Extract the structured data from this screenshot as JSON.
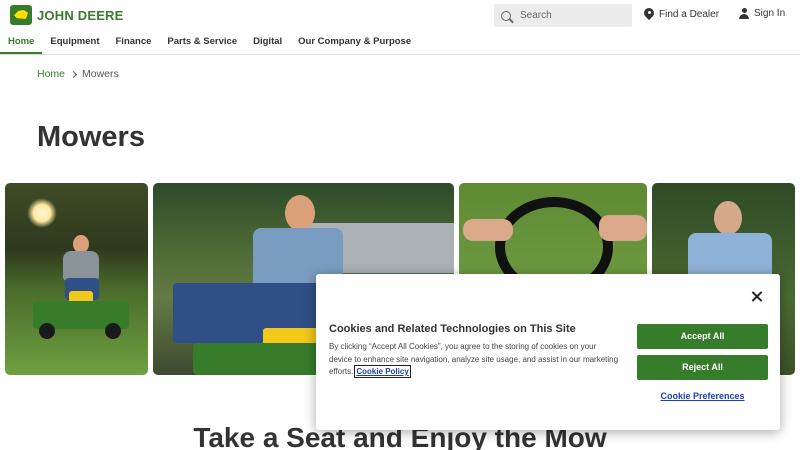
{
  "brand": {
    "logo_text": "JOHN DEERE",
    "logo_colors": {
      "green": "#367c2b",
      "yellow": "#ffde00"
    }
  },
  "header": {
    "search_placeholder": "Search",
    "find_dealer": "Find a Dealer",
    "sign_in": "Sign In"
  },
  "nav": {
    "items": [
      {
        "label": "Home",
        "active": true
      },
      {
        "label": "Equipment"
      },
      {
        "label": "Finance"
      },
      {
        "label": "Parts & Service"
      },
      {
        "label": "Digital"
      },
      {
        "label": "Our Company & Purpose"
      }
    ]
  },
  "breadcrumb": {
    "home": "Home",
    "current": "Mowers"
  },
  "page": {
    "title": "Mowers",
    "section_heading": "Take a Seat and Enjoy the Mow"
  },
  "cookie_banner": {
    "title": "Cookies and Related Technologies on This Site",
    "body": "By clicking “Accept All Cookies”, you agree to the storing of cookies on your device to enhance site navigation, analyze site usage, and assist in our marketing efforts.",
    "policy_link": "Cookie Policy",
    "accept_label": "Accept All",
    "reject_label": "Reject All",
    "preferences_label": "Cookie Preferences"
  },
  "icons": {
    "search": "search-icon",
    "dealer": "location-pin-icon",
    "sign_in": "person-icon",
    "breadcrumb_separator": "chevron-right-icon",
    "close": "close-icon"
  }
}
